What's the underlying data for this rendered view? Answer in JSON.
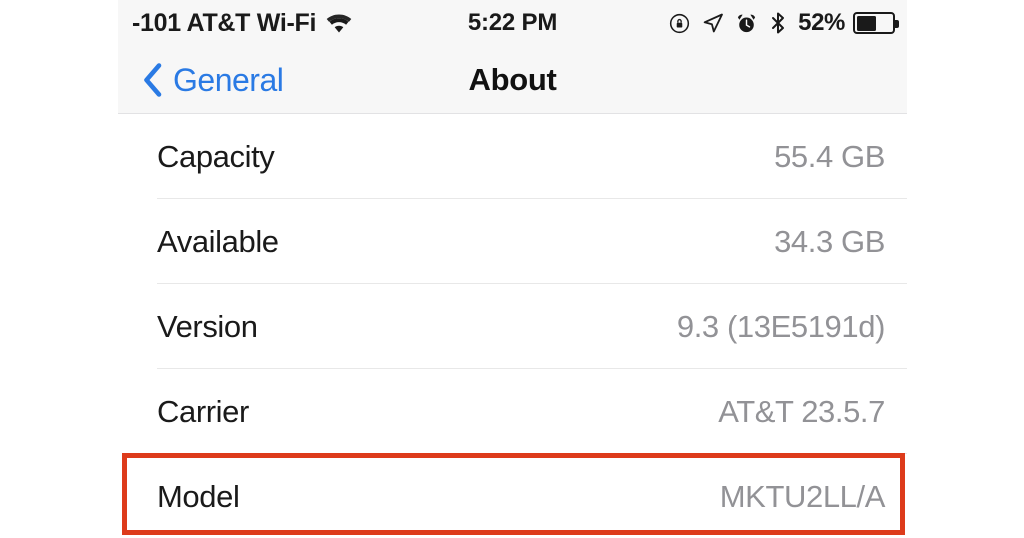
{
  "status_bar": {
    "carrier": "-101 AT&T Wi-Fi",
    "wifi_icon": "wifi-icon",
    "time": "5:22 PM",
    "icons": [
      "rotation-lock-icon",
      "location-arrow-icon",
      "alarm-clock-icon",
      "bluetooth-icon"
    ],
    "battery_percent": "52%",
    "battery_level": 52
  },
  "nav_bar": {
    "back_label": "General",
    "back_icon": "chevron-left-icon",
    "title": "About",
    "tint_color": "#2a7ae4"
  },
  "list": {
    "rows": [
      {
        "label": "Capacity",
        "value": "55.4 GB"
      },
      {
        "label": "Available",
        "value": "34.3 GB"
      },
      {
        "label": "Version",
        "value": "9.3 (13E5191d)"
      },
      {
        "label": "Carrier",
        "value": "AT&T 23.5.7"
      },
      {
        "label": "Model",
        "value": "MKTU2LL/A"
      }
    ]
  },
  "annotation": {
    "highlight_color": "#dd3b1b",
    "highlighted_row": "Model"
  }
}
